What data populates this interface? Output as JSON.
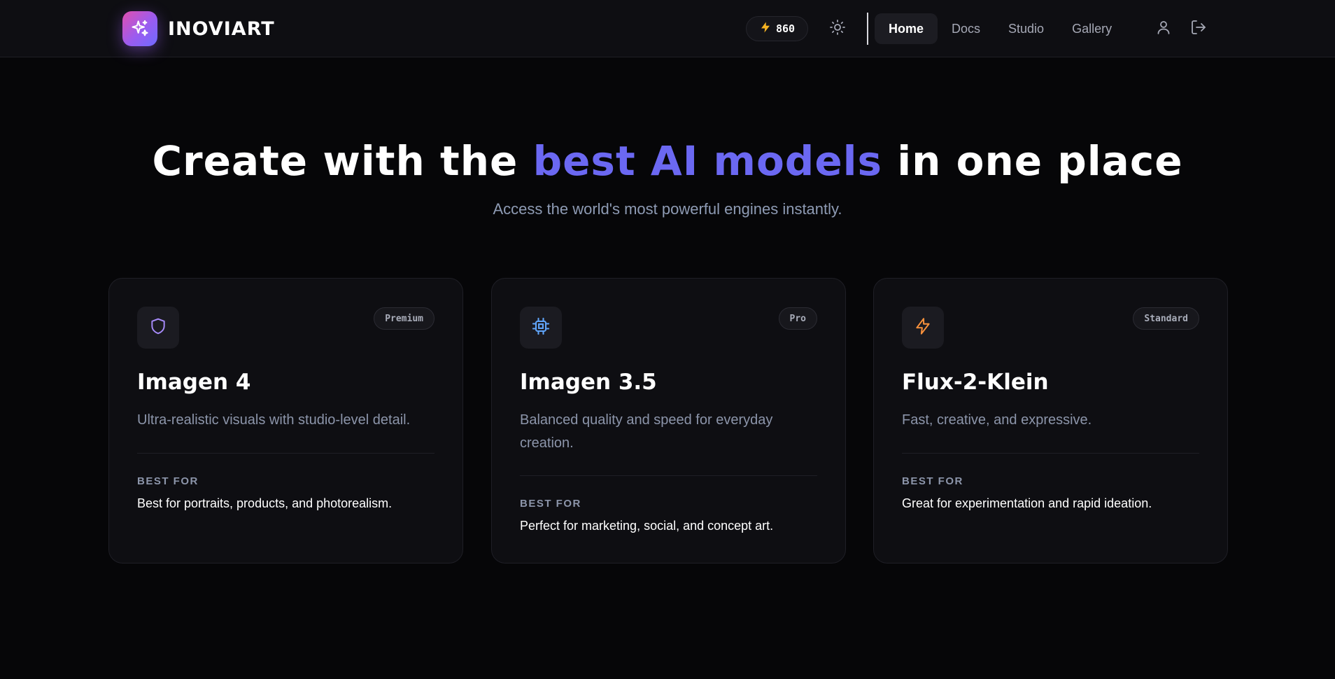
{
  "header": {
    "brand_name": "INOVIART",
    "logo_icon": "sparkles-icon",
    "credits": {
      "icon": "lightning-icon",
      "value": "860"
    },
    "theme_toggle_icon": "sun-icon",
    "nav": [
      {
        "label": "Home",
        "active": true
      },
      {
        "label": "Docs",
        "active": false
      },
      {
        "label": "Studio",
        "active": false
      },
      {
        "label": "Gallery",
        "active": false
      }
    ],
    "profile_icon": "user-icon",
    "logout_icon": "logout-icon"
  },
  "hero": {
    "title_before": "Create with the ",
    "title_accent": "best AI models",
    "title_after": " in one place",
    "subtitle": "Access the world's most powerful engines instantly."
  },
  "models": [
    {
      "icon": "shield-icon",
      "icon_color": "#a78bfa",
      "tier": "Premium",
      "name": "Imagen 4",
      "description": "Ultra-realistic visuals with studio-level detail.",
      "best_for_label": "BEST FOR",
      "best_for": "Best for portraits, products, and photorealism."
    },
    {
      "icon": "cpu-chip-icon",
      "icon_color": "#60a5fa",
      "tier": "Pro",
      "name": "Imagen 3.5",
      "description": "Balanced quality and speed for everyday creation.",
      "best_for_label": "BEST FOR",
      "best_for": "Perfect for marketing, social, and concept art."
    },
    {
      "icon": "lightning-icon",
      "icon_color": "#fb923c",
      "tier": "Standard",
      "name": "Flux-2-Klein",
      "description": "Fast, creative, and expressive.",
      "best_for_label": "BEST FOR",
      "best_for": "Great for experimentation and rapid ideation."
    }
  ],
  "colors": {
    "accent": "#6b68f2",
    "background": "#060608",
    "card_background": "#0e0e12",
    "muted_text": "#8c95aa"
  }
}
